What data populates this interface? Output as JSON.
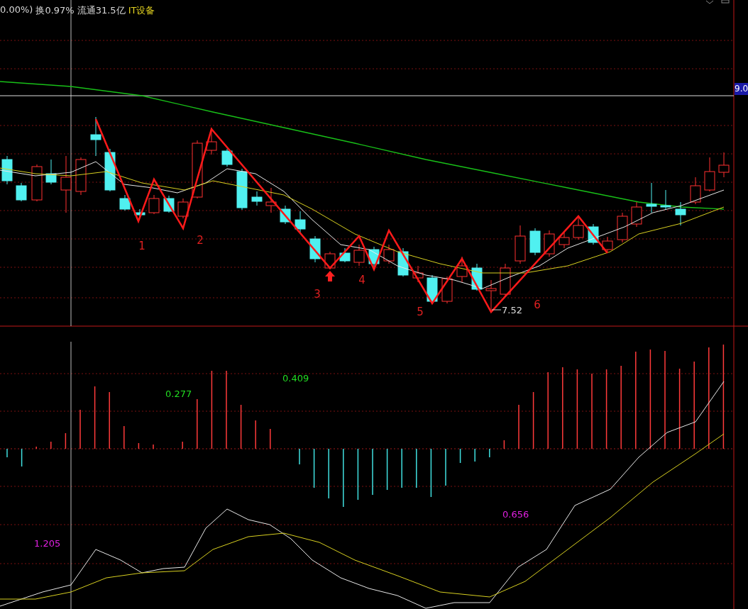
{
  "header": {
    "change": "0.00%)",
    "turnover": "换0.97%",
    "float_cap": "流通31.5亿",
    "sector": "IT设备"
  },
  "price_panel": {
    "axis_label": "9.0",
    "low_label": "7.52",
    "wave_labels": [
      {
        "text": "1"
      },
      {
        "text": "2"
      },
      {
        "text": "3"
      },
      {
        "text": "4"
      },
      {
        "text": "5"
      },
      {
        "text": "6"
      }
    ]
  },
  "indicator_panel": {
    "labels": [
      {
        "text": "0.277",
        "kind": "green"
      },
      {
        "text": "0.409",
        "kind": "green"
      },
      {
        "text": "1.205",
        "kind": "magenta"
      },
      {
        "text": "0.656",
        "kind": "magenta"
      }
    ]
  }
}
